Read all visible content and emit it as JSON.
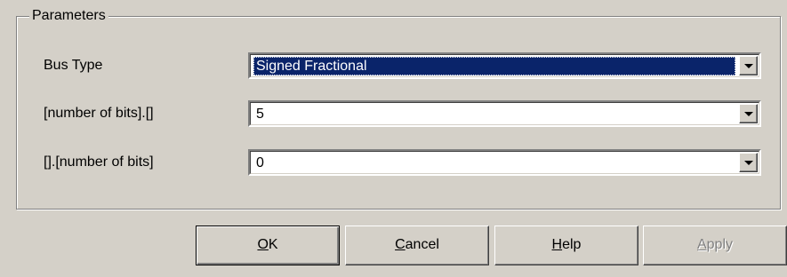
{
  "parameters": {
    "group_title": "Parameters",
    "rows": [
      {
        "label": "Bus Type",
        "value": "Signed Fractional"
      },
      {
        "label": "[number of bits].[]",
        "value": "5"
      },
      {
        "label": "[].[number of bits]",
        "value": "0"
      }
    ]
  },
  "buttons": {
    "ok": {
      "mnemonic": "O",
      "rest": "K"
    },
    "cancel": {
      "mnemonic": "C",
      "rest": "ancel"
    },
    "help": {
      "mnemonic": "H",
      "rest": "elp"
    },
    "apply": {
      "mnemonic": "A",
      "rest": "pply",
      "state": "disabled"
    }
  },
  "colors": {
    "dialog_bg": "#d4d0c8",
    "selection_bg": "#0a246a",
    "disabled_text": "#808080"
  },
  "icons": {
    "dropdown": "chevron-down-icon"
  }
}
